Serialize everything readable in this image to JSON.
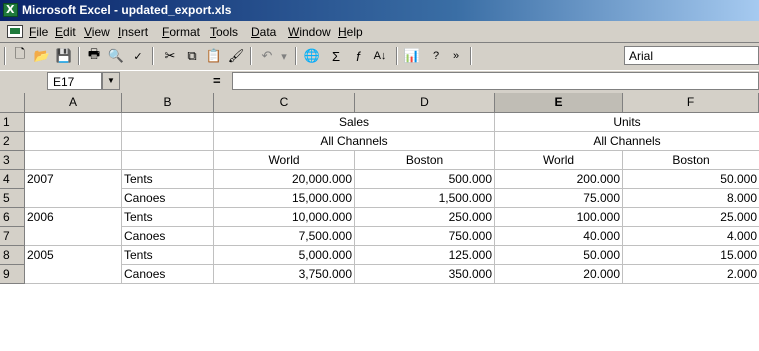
{
  "window": {
    "title": "Microsoft Excel - updated_export.xls"
  },
  "menu": [
    "File",
    "Edit",
    "View",
    "Insert",
    "Format",
    "Tools",
    "Data",
    "Window",
    "Help"
  ],
  "toolbar": {
    "font_name": "Arial",
    "icons": [
      "new-icon",
      "open-icon",
      "save-icon",
      "print-icon",
      "print-preview-icon",
      "spelling-icon",
      "cut-icon",
      "copy-icon",
      "paste-icon",
      "format-painter-icon",
      "undo-icon",
      "hyperlink-icon",
      "autosum-icon",
      "function-icon",
      "sort-ascending-icon",
      "chart-wizard-icon",
      "help-icon",
      "toolbar-options-icon"
    ]
  },
  "formula_bar": {
    "name_box": "E17",
    "equals": "=",
    "formula": ""
  },
  "columns": [
    "A",
    "B",
    "C",
    "D",
    "E",
    "F"
  ],
  "rows": [
    "1",
    "2",
    "3",
    "4",
    "5",
    "6",
    "7",
    "8",
    "9"
  ],
  "sheet": {
    "sales_header": "Sales",
    "units_header": "Units",
    "all_channels_sales": "All Channels",
    "all_channels_units": "All Channels",
    "sub_headers": [
      "World",
      "Boston",
      "World",
      "Boston"
    ],
    "data": [
      [
        "2007",
        "Tents",
        "20,000.000",
        "500.000",
        "200.000",
        "50.000"
      ],
      [
        "",
        "Canoes",
        "15,000.000",
        "1,500.000",
        "75.000",
        "8.000"
      ],
      [
        "2006",
        "Tents",
        "10,000.000",
        "250.000",
        "100.000",
        "25.000"
      ],
      [
        "",
        "Canoes",
        "7,500.000",
        "750.000",
        "40.000",
        "4.000"
      ],
      [
        "2005",
        "Tents",
        "5,000.000",
        "125.000",
        "50.000",
        "15.000"
      ],
      [
        "",
        "Canoes",
        "3,750.000",
        "350.000",
        "20.000",
        "2.000"
      ]
    ]
  }
}
